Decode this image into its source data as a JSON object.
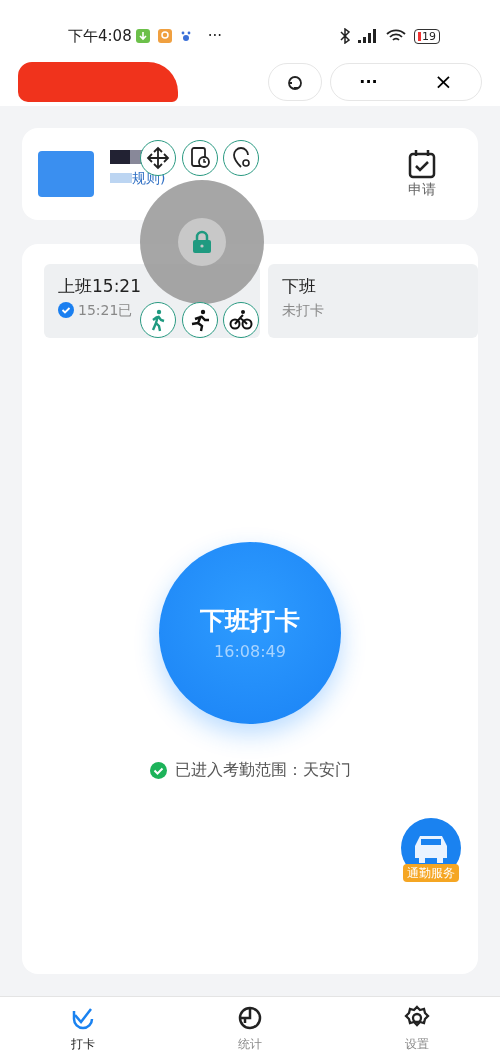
{
  "status_bar": {
    "time": "下午4:08",
    "more": "···",
    "battery": "19"
  },
  "header": {
    "more": "···",
    "close": "×"
  },
  "group_card": {
    "subtitle": "规则)",
    "apply_label": "申请"
  },
  "punches": [
    {
      "title": "上班15:21",
      "status": "15:21已",
      "done": true
    },
    {
      "title": "下班",
      "status": "未打卡",
      "done": false
    }
  ],
  "punch_button": {
    "label": "下班打卡",
    "time": "16:08:49"
  },
  "location": {
    "text": "已进入考勤范围：天安门",
    "in_range": true
  },
  "commute": {
    "label": "通勤服务"
  },
  "tabs": [
    {
      "label": "打卡",
      "kind": "check",
      "selected": true
    },
    {
      "label": "统计",
      "kind": "chart",
      "selected": false
    },
    {
      "label": "设置",
      "kind": "gear",
      "selected": false
    }
  ]
}
